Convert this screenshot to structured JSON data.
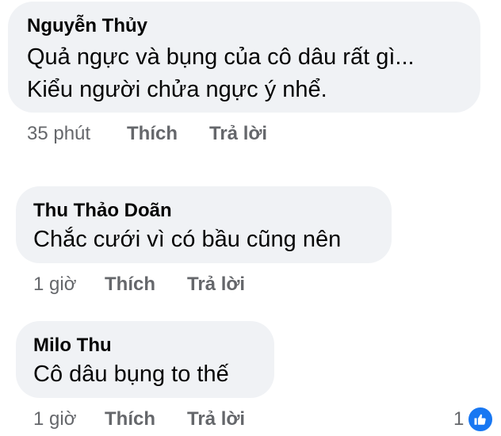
{
  "comments": [
    {
      "author": "Nguyễn Thủy",
      "lines": [
        "Quả ngực và bụng của cô dâu  rất gì...",
        "Kiểu người chửa ngực ý nhể."
      ],
      "time": "35 phút",
      "like": "Thích",
      "reply": "Trả lời"
    },
    {
      "author": "Thu Thảo Doãn",
      "lines": [
        "Chắc cưới vì có bầu cũng nên"
      ],
      "time": "1 giờ",
      "like": "Thích",
      "reply": "Trả lời"
    },
    {
      "author": "Milo Thu",
      "lines": [
        "Cô dâu bụng to thế"
      ],
      "time": "1 giờ",
      "like": "Thích",
      "reply": "Trả lời",
      "reaction_count": "1"
    }
  ],
  "colors": {
    "bubble": "#f0f2f5",
    "meta": "#65676b",
    "like_blue": "#1877f2"
  },
  "icons": {
    "reaction": "thumbs-up-icon"
  }
}
